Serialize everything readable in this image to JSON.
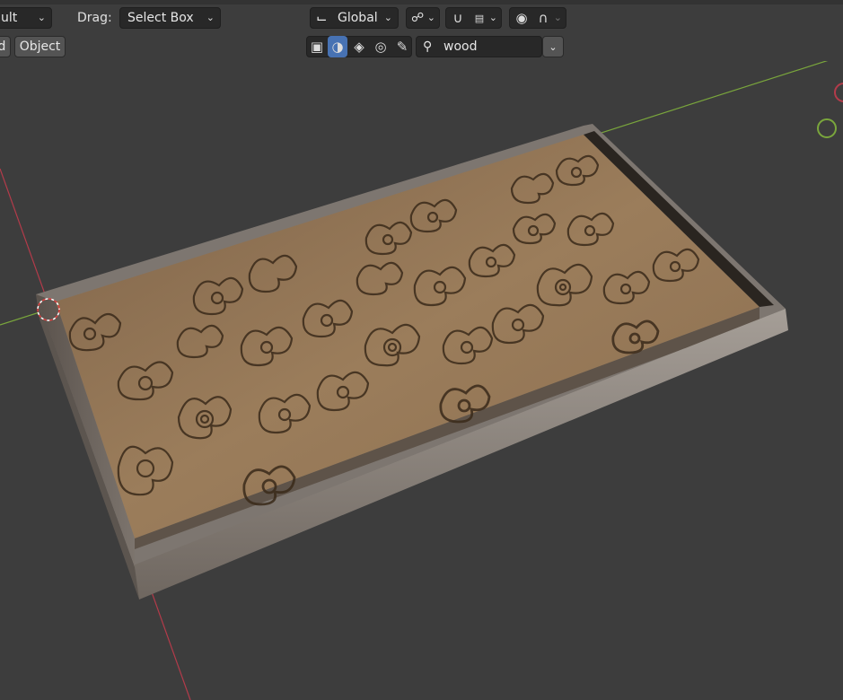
{
  "header": {
    "transform_pivot_value": "ult",
    "drag_label": "Drag:",
    "drag_value": "Select Box",
    "transform_orientation": "Global",
    "mode_left_partial": "d",
    "object_menu": "Object",
    "search_value": "wood"
  },
  "icons": {
    "orientation": "axes-icon",
    "pivot": "link-icon",
    "snap": "magnet-icon",
    "snap_target": "increment-icon",
    "proportional": "proportional-dot-icon",
    "falloff": "falloff-curve-icon",
    "mode_object": "cube-icon",
    "mode_material": "material-sphere-icon",
    "mode_texture": "texture-drop-icon",
    "mode_world": "world-icon",
    "mode_brush": "brush-icon",
    "search": "search-icon",
    "search_dropdown": "chevron-down-icon"
  },
  "colors": {
    "header_bg": "#3d3d3d",
    "widget_bg": "#282828",
    "accent_active": "#4772b3",
    "x_axis": "#b33b4a",
    "y_axis": "#7aa63c",
    "wood": "#8a6e4f"
  }
}
